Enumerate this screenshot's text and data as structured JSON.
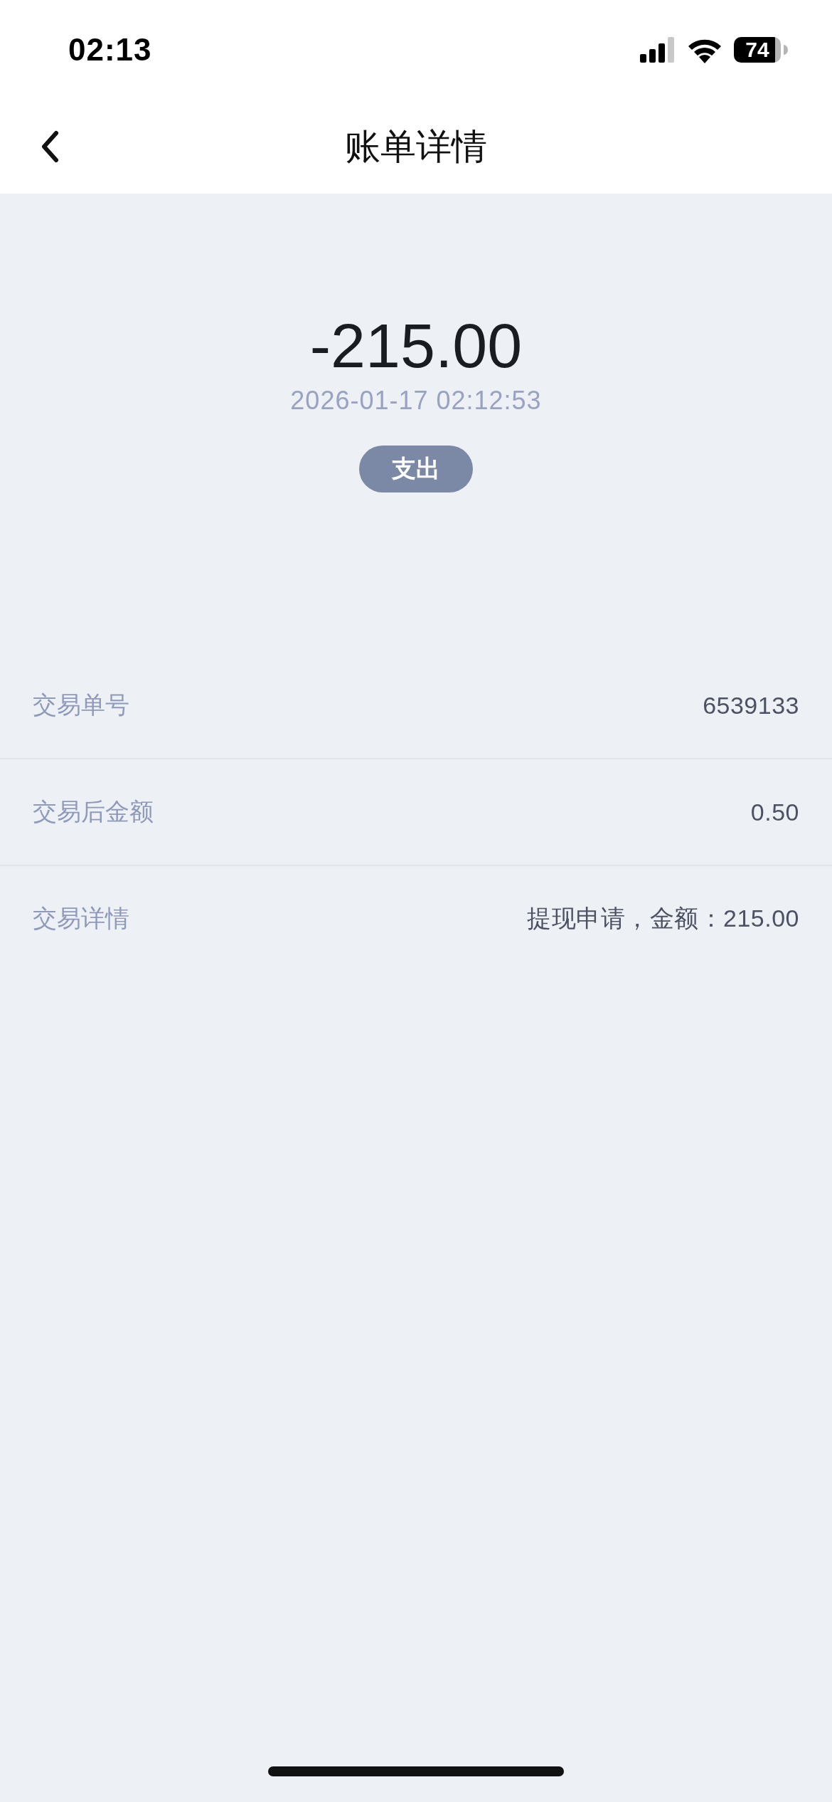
{
  "status_bar": {
    "time": "02:13",
    "battery": "74"
  },
  "nav_bar": {
    "title": "账单详情"
  },
  "summary": {
    "amount": "-215.00",
    "datetime": "2026-01-17 02:12:53",
    "type_tag": "支出"
  },
  "details": [
    {
      "label": "交易单号",
      "value": "6539133"
    },
    {
      "label": "交易后金额",
      "value": "0.50"
    },
    {
      "label": "交易详情",
      "value": "提现申请，金额：215.00"
    }
  ]
}
